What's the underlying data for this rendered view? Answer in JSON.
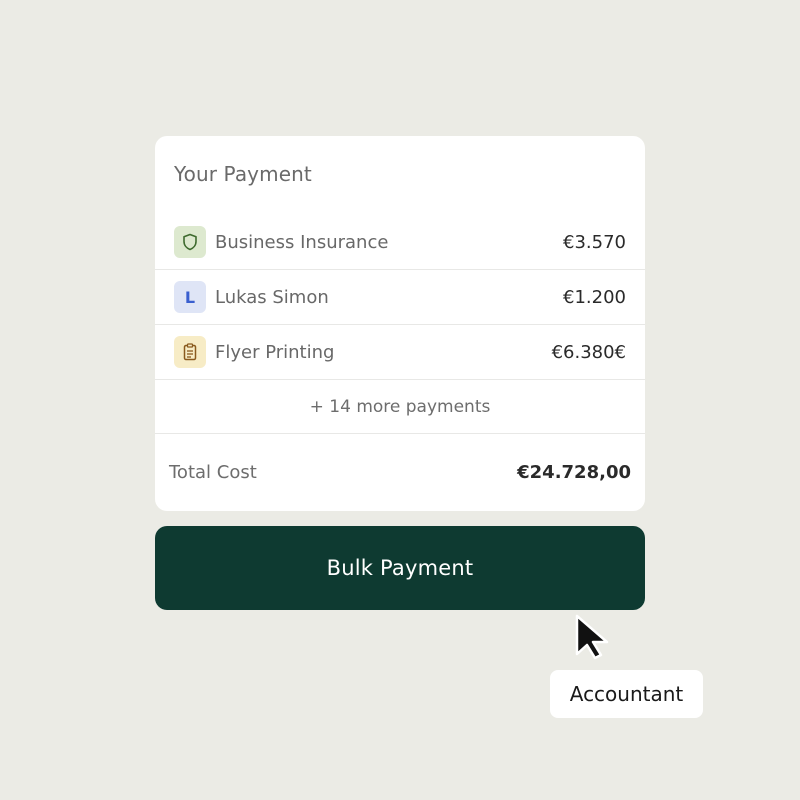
{
  "payment_card": {
    "title": "Your Payment",
    "items": [
      {
        "icon": "shield-icon",
        "label": "Business Insurance",
        "amount": "€3.570",
        "icon_bg": "#dde9cf",
        "icon_color": "#3f6b2f"
      },
      {
        "icon": "letter-avatar",
        "letter": "L",
        "label": "Lukas Simon",
        "amount": "€1.200",
        "icon_bg": "#dfe5f6",
        "icon_color": "#3a5fcf"
      },
      {
        "icon": "clipboard-icon",
        "label": "Flyer Printing",
        "amount": "€6.380€",
        "icon_bg": "#f7ecc6",
        "icon_color": "#8a5a1e"
      }
    ],
    "more_label": "+ 14 more payments",
    "total_label": "Total Cost",
    "total_amount": "€24.728,00"
  },
  "bulk_button": {
    "label": "Bulk Payment",
    "color": "#0e3a31"
  },
  "cursor_tag": {
    "label": "Accountant"
  },
  "background_color": "#ebebe5"
}
